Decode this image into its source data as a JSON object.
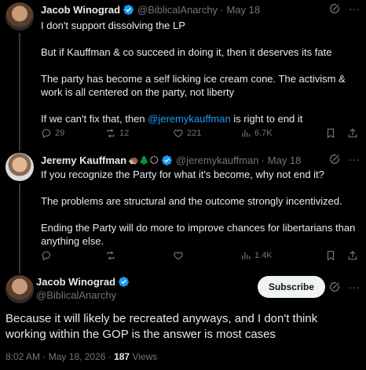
{
  "tweet1": {
    "name": "Jacob Winograd",
    "handle": "@BiblicalAnarchy",
    "dot": "·",
    "date": "May 18",
    "paragraphs": [
      "I don't support dissolving the LP",
      "But if Kauffman & co succeed in doing it, then it deserves its fate",
      "The party has become a self licking ice cream cone. The activism & work is all centered on the party, not liberty"
    ],
    "last_pre": "If we can't fix that, then ",
    "last_mention": "@jeremykauffman",
    "last_post": " is right to end it",
    "replies": "29",
    "reposts": "12",
    "likes": "221",
    "views": "6.7K"
  },
  "tweet2": {
    "name": "Jeremy Kauffman",
    "emojis": "🦔🌲🌕",
    "handle": "@jeremykauffman",
    "dot": "·",
    "date": "May 18",
    "paragraphs": [
      "If you recognize the Party for what it's become, why not end it?",
      "The problems are structural and the outcome strongly incentivized.",
      "Ending the Party will do more to improve chances for libertarians than anything else."
    ],
    "views": "1.4K"
  },
  "tweet3": {
    "name": "Jacob Winograd",
    "handle": "@BiblicalAnarchy",
    "subscribe_label": "Subscribe",
    "text": "Because it will likely be recreated anyways, and I don't think working within the GOP is the answer is most cases",
    "time": "8:02 AM · May 18, 2026 · ",
    "views_count": "187",
    "views_label": " Views"
  },
  "colors": {
    "accent": "#1d9bf0",
    "muted": "#71767b",
    "text": "#e7e9ea",
    "background": "#000000"
  }
}
